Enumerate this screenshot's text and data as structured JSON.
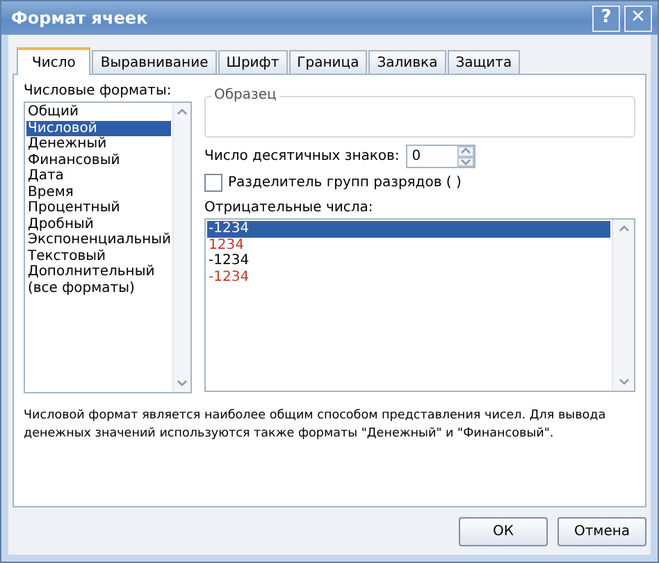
{
  "window": {
    "title": "Формат ячеек",
    "help": "?",
    "close": "✕"
  },
  "tabs": [
    {
      "label": "Число",
      "selected": true
    },
    {
      "label": "Выравнивание",
      "selected": false
    },
    {
      "label": "Шрифт",
      "selected": false
    },
    {
      "label": "Граница",
      "selected": false
    },
    {
      "label": "Заливка",
      "selected": false
    },
    {
      "label": "Защита",
      "selected": false
    }
  ],
  "formats": {
    "label": "Числовые форматы:",
    "items": [
      {
        "label": "Общий",
        "selected": false
      },
      {
        "label": "Числовой",
        "selected": true
      },
      {
        "label": "Денежный",
        "selected": false
      },
      {
        "label": "Финансовый",
        "selected": false
      },
      {
        "label": "Дата",
        "selected": false
      },
      {
        "label": "Время",
        "selected": false
      },
      {
        "label": "Процентный",
        "selected": false
      },
      {
        "label": "Дробный",
        "selected": false
      },
      {
        "label": "Экспоненциальный",
        "selected": false
      },
      {
        "label": "Текстовый",
        "selected": false
      },
      {
        "label": "Дополнительный",
        "selected": false
      },
      {
        "label": "(все форматы)",
        "selected": false
      }
    ]
  },
  "sample": {
    "label": "Образец"
  },
  "decimals": {
    "label": "Число десятичных знаков:",
    "value": "0"
  },
  "separator": {
    "label": "Разделитель групп разрядов ( )",
    "checked": false
  },
  "negatives": {
    "label": "Отрицательные числа:",
    "items": [
      {
        "label": "-1234",
        "selected": true
      },
      {
        "label": "1234",
        "color": "#c0392b",
        "selected": false
      },
      {
        "label": "-1234",
        "color": "#000000",
        "selected": false
      },
      {
        "label": "-1234",
        "color": "#c0392b",
        "selected": false
      }
    ]
  },
  "description": "Числовой формат является наиболее общим способом представления чисел. Для вывода денежных значений используются также форматы \"Денежный\" и \"Финансовый\".",
  "buttons": [
    "ОК",
    "Отмена"
  ]
}
